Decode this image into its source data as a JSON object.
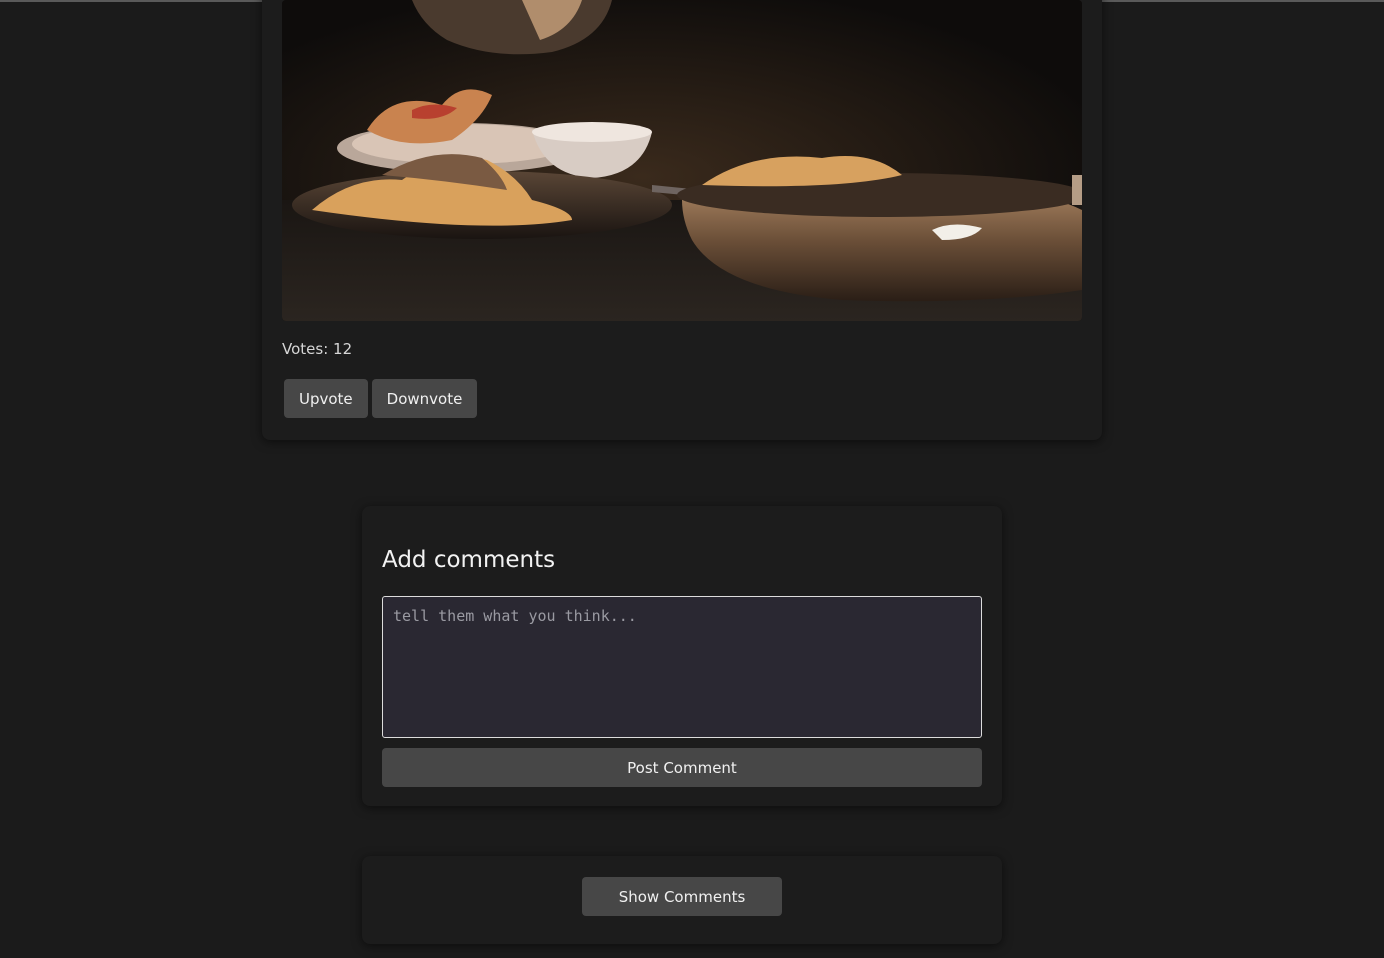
{
  "post": {
    "votes_label": "Votes: 12",
    "upvote_label": "Upvote",
    "downvote_label": "Downvote"
  },
  "comments": {
    "title": "Add comments",
    "placeholder": "tell them what you think...",
    "post_label": "Post Comment",
    "show_label": "Show Comments"
  },
  "colors": {
    "background": "#1b1b1b",
    "card": "#1c1c1c",
    "button": "#474747",
    "textarea": "#2a2832"
  }
}
